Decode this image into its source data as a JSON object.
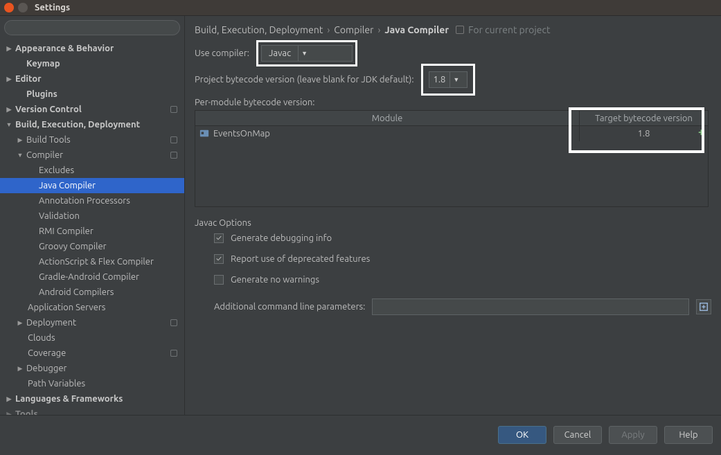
{
  "window": {
    "title": "Settings"
  },
  "search": {
    "placeholder": ""
  },
  "tree": {
    "appearance": "Appearance & Behavior",
    "keymap": "Keymap",
    "editor": "Editor",
    "plugins": "Plugins",
    "vcs": "Version Control",
    "bed": "Build, Execution, Deployment",
    "buildtools": "Build Tools",
    "compiler": "Compiler",
    "excludes": "Excludes",
    "java": "Java Compiler",
    "annotation": "Annotation Processors",
    "validation": "Validation",
    "rmi": "RMI Compiler",
    "groovy": "Groovy Compiler",
    "asflex": "ActionScript & Flex Compiler",
    "gradleandroid": "Gradle-Android Compiler",
    "android": "Android Compilers",
    "appservers": "Application Servers",
    "deployment": "Deployment",
    "clouds": "Clouds",
    "coverage": "Coverage",
    "debugger": "Debugger",
    "pathvars": "Path Variables",
    "langfw": "Languages & Frameworks",
    "tools": "Tools"
  },
  "crumbs": {
    "a": "Build, Execution, Deployment",
    "b": "Compiler",
    "c": "Java Compiler",
    "for": "For current project"
  },
  "form": {
    "use_compiler_label": "Use compiler:",
    "use_compiler_value": "Javac",
    "proj_bc_label": "Project bytecode version (leave blank for JDK default):",
    "proj_bc_value": "1.8",
    "per_module_label": "Per-module bytecode version:",
    "table": {
      "col_module": "Module",
      "col_target": "Target bytecode version",
      "module_name": "EventsOnMap",
      "module_target": "1.8"
    },
    "javac_opts": "Javac Options",
    "gen_debug": "Generate debugging info",
    "report_deprecated": "Report use of deprecated features",
    "gen_no_warn": "Generate no warnings",
    "addl_params_label": "Additional command line parameters:",
    "addl_params_value": ""
  },
  "buttons": {
    "ok": "OK",
    "cancel": "Cancel",
    "apply": "Apply",
    "help": "Help"
  }
}
